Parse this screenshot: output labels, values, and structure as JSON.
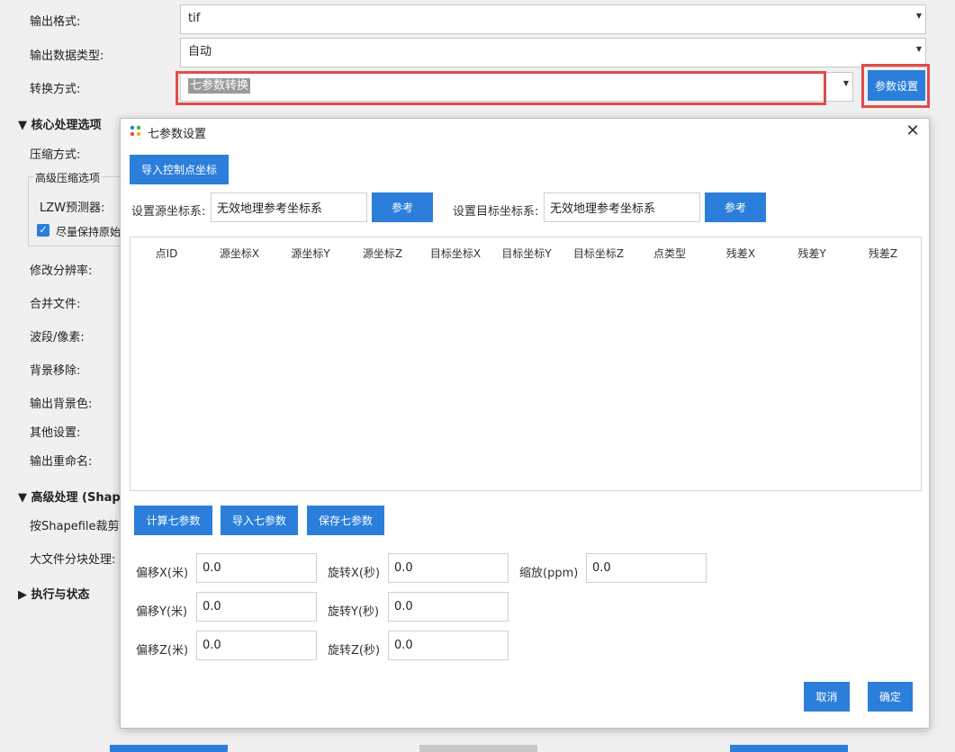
{
  "background": {
    "fields": [
      {
        "label": "输出格式:",
        "value": "tif"
      },
      {
        "label": "输出数据类型:",
        "value": "自动"
      },
      {
        "label": "转换方式:",
        "value": "七参数转换"
      }
    ],
    "param_button": "参数设置",
    "core_section": "▼ 核心处理选项",
    "compress_label": "压缩方式:",
    "adv_compress_group": "高级压缩选项",
    "lzw_label": "LZW预测器:",
    "keep_original": "尽量保持原始",
    "labels": [
      "修改分辨率:",
      "合并文件:",
      "波段/像素:",
      "背景移除:",
      "输出背景色:",
      "其他设置:",
      "输出重命名:"
    ],
    "adv_section": "▼ 高级处理 (Shape",
    "shp_clip": "按Shapefile裁剪:",
    "big_file": "大文件分块处理:",
    "exec_section": "▶ 执行与状态"
  },
  "dialog": {
    "title": "七参数设置",
    "close": "✕",
    "import_ctrl": "导入控制点坐标",
    "src_label": "设置源坐标系:",
    "src_value": "无效地理参考坐标系",
    "ref_button": "参考",
    "dst_label": "设置目标坐标系:",
    "dst_value": "无效地理参考坐标系",
    "columns": [
      "点ID",
      "源坐标X",
      "源坐标Y",
      "源坐标Z",
      "目标坐标X",
      "目标坐标Y",
      "目标坐标Z",
      "点类型",
      "残差X",
      "残差Y",
      "残差Z"
    ],
    "calc_button": "计算七参数",
    "import_button": "导入七参数",
    "save_button": "保存七参数",
    "params": {
      "offset_x_label": "偏移X(米)",
      "offset_x": "0.0",
      "offset_y_label": "偏移Y(米)",
      "offset_y": "0.0",
      "offset_z_label": "偏移Z(米)",
      "offset_z": "0.0",
      "rot_x_label": "旋转X(秒)",
      "rot_x": "0.0",
      "rot_y_label": "旋转Y(秒)",
      "rot_y": "0.0",
      "rot_z_label": "旋转Z(秒)",
      "rot_z": "0.0",
      "scale_label": "缩放(ppm)",
      "scale": "0.0"
    },
    "cancel": "取消",
    "ok": "确定"
  },
  "colors": {
    "accent": "#2b7fdb",
    "highlight": "#e24b4b"
  }
}
